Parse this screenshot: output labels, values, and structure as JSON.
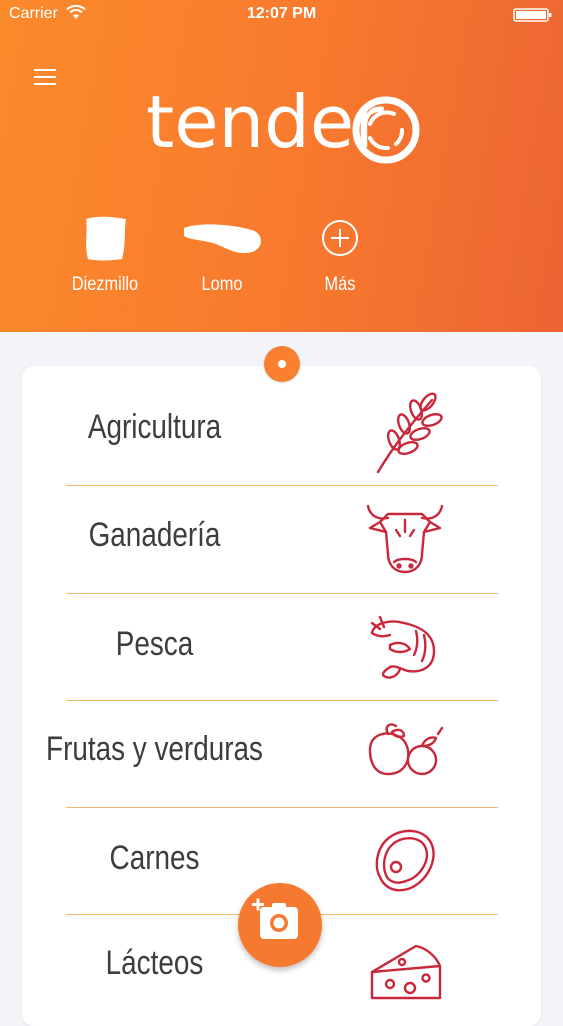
{
  "status_bar": {
    "carrier": "Carrier",
    "time": "12:07 PM"
  },
  "header": {
    "logo_text": "tender",
    "quick_items": [
      {
        "label": "Diezmillo",
        "icon": "beef-cut-icon"
      },
      {
        "label": "Lomo",
        "icon": "loin-cut-icon"
      },
      {
        "label": "Más",
        "icon": "plus-circle-icon"
      }
    ]
  },
  "categories": [
    {
      "label": "Agricultura",
      "icon": "wheat-icon"
    },
    {
      "label": "Ganadería",
      "icon": "cow-icon"
    },
    {
      "label": "Pesca",
      "icon": "shrimp-icon"
    },
    {
      "label": "Frutas y verduras",
      "icon": "fruit-icon"
    },
    {
      "label": "Carnes",
      "icon": "steak-icon"
    },
    {
      "label": "Lácteos",
      "icon": "cheese-icon"
    }
  ],
  "colors": {
    "brand_orange": "#f8792e",
    "icon_red": "#c8283a",
    "separator": "#f3b86b"
  }
}
